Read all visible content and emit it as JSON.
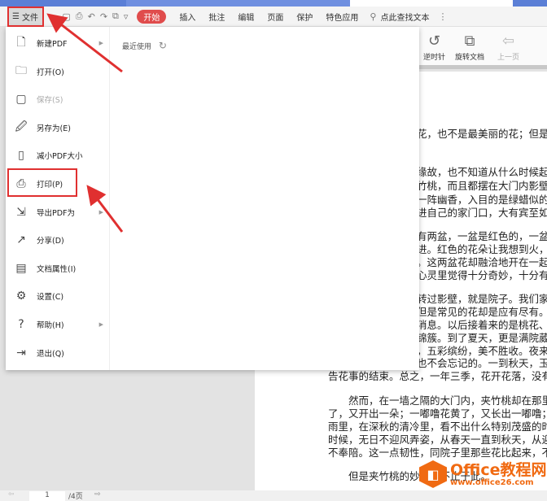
{
  "toolbar": {
    "file": "文件",
    "start": "开始",
    "tabs": [
      "插入",
      "批注",
      "编辑",
      "页面",
      "保护",
      "特色应用"
    ],
    "search": "点此查找文本"
  },
  "ribbon": {
    "buttons": [
      "逆时针",
      "旋转文档",
      "上一页"
    ]
  },
  "menu": {
    "recent": "最近使用",
    "items": [
      {
        "label": "新建PDF",
        "icon": "new-pdf-icon",
        "arrow": true
      },
      {
        "label": "打开(O)",
        "icon": "folder-icon"
      },
      {
        "label": "保存(S)",
        "icon": "save-icon",
        "disabled": true
      },
      {
        "label": "另存为(E)",
        "icon": "save-as-icon"
      },
      {
        "label": "减小PDF大小",
        "icon": "compress-icon"
      },
      {
        "label": "打印(P)",
        "icon": "printer-icon"
      },
      {
        "label": "导出PDF为",
        "icon": "export-icon",
        "arrow": true
      },
      {
        "label": "分享(D)",
        "icon": "share-icon"
      },
      {
        "label": "文档属性(I)",
        "icon": "properties-icon"
      },
      {
        "label": "设置(C)",
        "icon": "gear-icon"
      },
      {
        "label": "帮助(H)",
        "icon": "help-icon",
        "arrow": true
      },
      {
        "label": "退出(Q)",
        "icon": "exit-icon"
      }
    ]
  },
  "document": {
    "lines": [
      "花，也不是最美丽的花；但是，",
      "缘故，也不知道从什么时候起",
      "竹桃，而且都摆在大门内影壁",
      "一阵幽香，入目的是绿蜡似的",
      "进自己的家门口，大有宾至如",
      "有两盆，一盆是红色的，一盆",
      "进。红色的花朵让我想到火，",
      "。这两盆花却融洽地开在一起，",
      "心灵里觉得十分奇妙，十分有",
      "转过影壁，就是院子。我们家",
      "但是常见的花却是应有尽有。",
      "消息。以后接着来的是桃花、",
      "锦簇。到了夏天，更是满院葳",
      "，五彩缤纷，美不胜收。夜来",
      "也不会忘记的。一到秋天，玉",
      "告花事的结束。总之，一年三季，花开花落，没有",
      "然而，在一墙之隔的大门内，夹竹桃却在那里",
      "了，又开出一朵；一嘟噜花黄了，又长出一嘟噜；",
      "雨里，在深秋的清冷里，看不出什么特别茂盛的时",
      "时候，无日不迎风弄姿，从春天一直到秋天，从迎",
      "不奉陪。这一点韧性，同院子里那些花比起来，不",
      "但是夹竹桃的妙处还不止于此。"
    ]
  },
  "status": {
    "page": "1",
    "total": "/4页"
  },
  "watermark": {
    "title": "Office教程网",
    "url": "www.office26.com"
  }
}
